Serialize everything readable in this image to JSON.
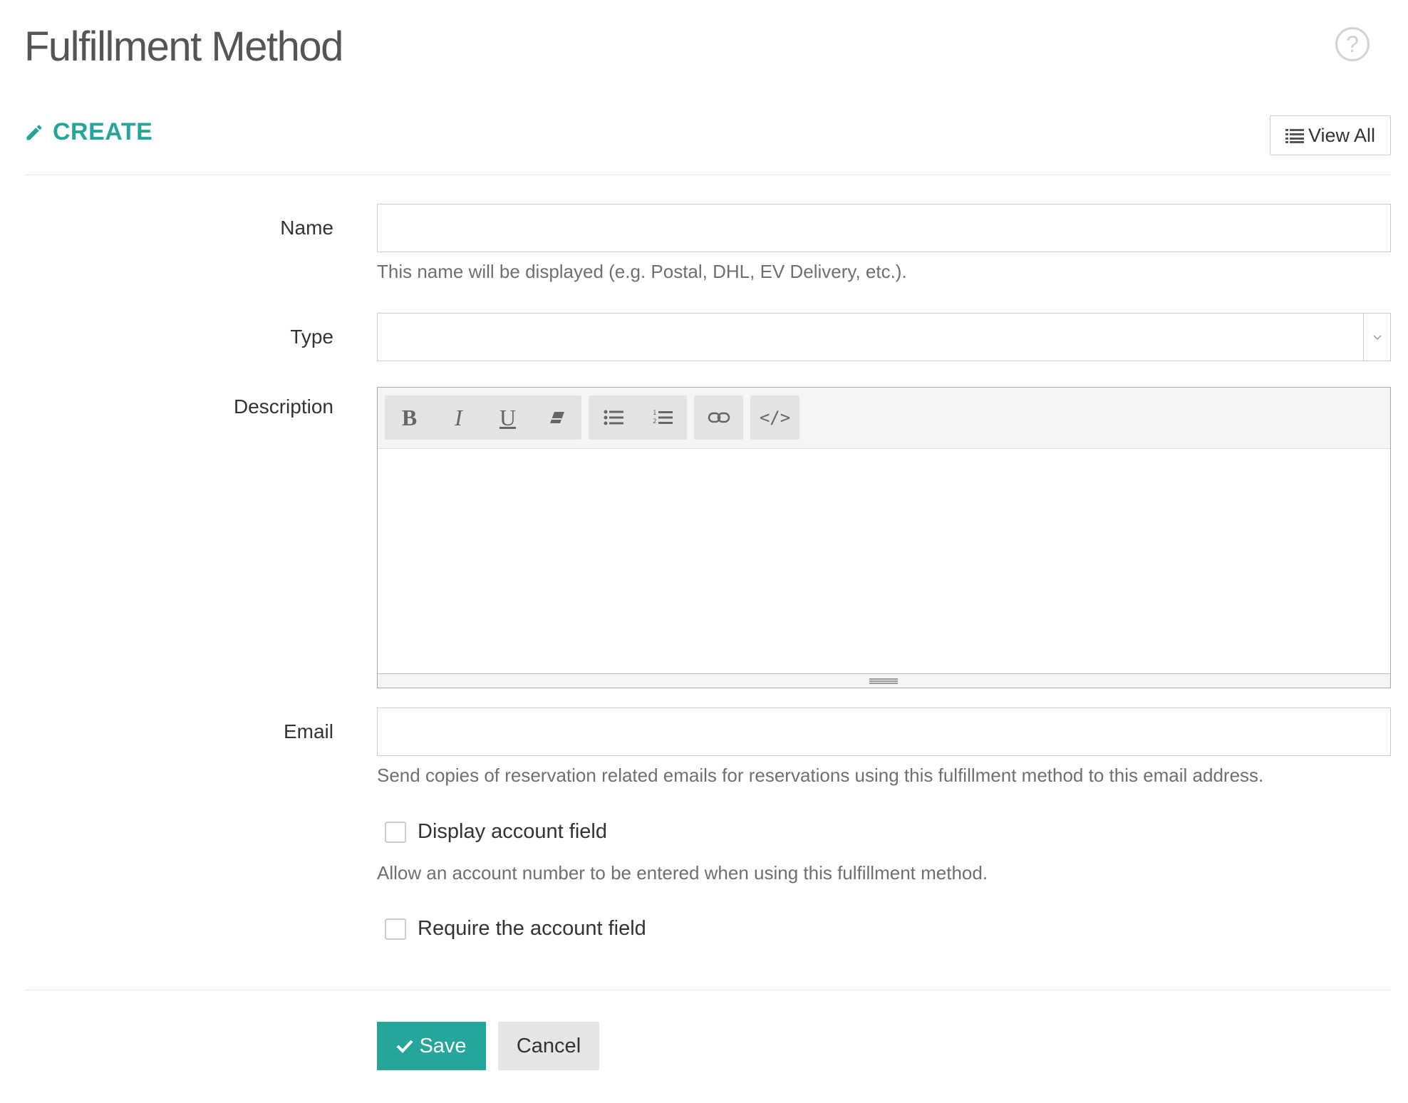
{
  "header": {
    "title": "Fulfillment Method",
    "help_icon_glyph": "?"
  },
  "section": {
    "title": "CREATE",
    "view_all_label": "View All"
  },
  "form": {
    "name": {
      "label": "Name",
      "value": "",
      "help": "This name will be displayed (e.g. Postal, DHL, EV Delivery, etc.)."
    },
    "type": {
      "label": "Type",
      "selected": ""
    },
    "description": {
      "label": "Description",
      "toolbar": [
        "bold",
        "italic",
        "underline",
        "eraser",
        "bullet-list",
        "numbered-list",
        "link",
        "code-view"
      ],
      "value": ""
    },
    "email": {
      "label": "Email",
      "value": "",
      "help": "Send copies of reservation related emails for reservations using this fulfillment method to this email address."
    },
    "display_account_field": {
      "label": "Display account field",
      "checked": false,
      "help": "Allow an account number to be entered when using this fulfillment method."
    },
    "require_account_field": {
      "label": "Require the account field",
      "checked": false
    }
  },
  "actions": {
    "save_label": "Save",
    "cancel_label": "Cancel"
  },
  "colors": {
    "accent": "#26a69a",
    "border": "#cccccc",
    "title": "#555555"
  }
}
